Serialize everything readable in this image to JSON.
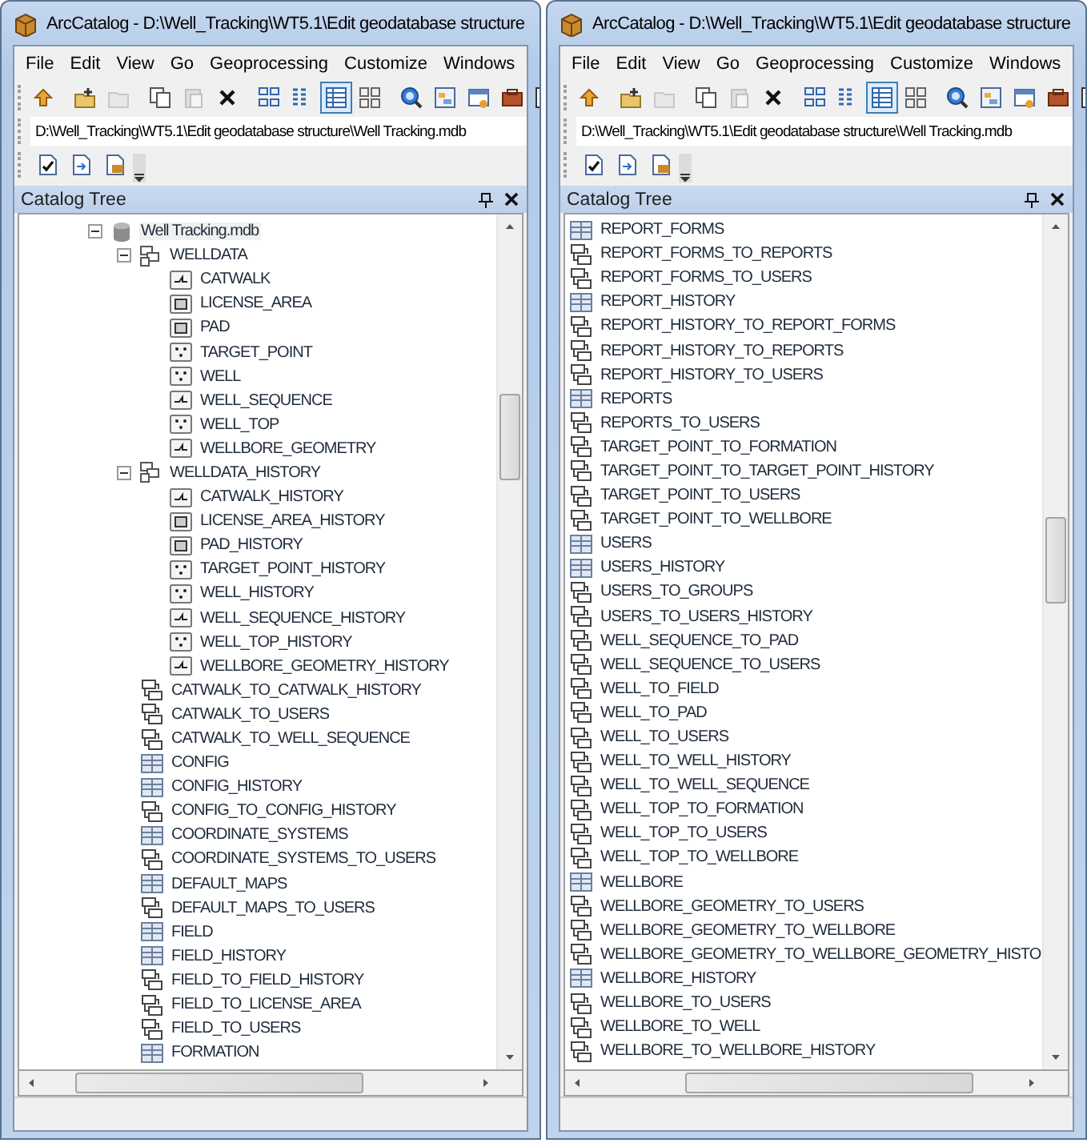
{
  "windows": [
    {
      "title": "ArcCatalog - D:\\Well_Tracking\\WT5.1\\Edit geodatabase structure",
      "menu": [
        "File",
        "Edit",
        "View",
        "Go",
        "Geoprocessing",
        "Customize",
        "Windows"
      ],
      "toolbar": [
        {
          "kind": "up",
          "disabled": false
        },
        {
          "kind": "separator"
        },
        {
          "kind": "connect",
          "disabled": false
        },
        {
          "kind": "disconnect",
          "disabled": true
        },
        {
          "kind": "separator"
        },
        {
          "kind": "copy",
          "disabled": false
        },
        {
          "kind": "paste",
          "disabled": true
        },
        {
          "kind": "delete",
          "disabled": false
        },
        {
          "kind": "separator"
        },
        {
          "kind": "view-large",
          "selected": false
        },
        {
          "kind": "view-list",
          "selected": false
        },
        {
          "kind": "view-details",
          "selected": true
        },
        {
          "kind": "view-thumbnails",
          "selected": false
        },
        {
          "kind": "separator"
        },
        {
          "kind": "search",
          "disabled": false
        },
        {
          "kind": "catalog",
          "disabled": false
        },
        {
          "kind": "window",
          "disabled": false
        },
        {
          "kind": "toolbox",
          "disabled": false
        },
        {
          "kind": "python",
          "disabled": false
        }
      ],
      "path": "D:\\Well_Tracking\\WT5.1\\Edit geodatabase structure\\Well Tracking.mdb",
      "panel_title": "Catalog Tree",
      "tree": [
        {
          "label": "Well Tracking.mdb",
          "kind": "database",
          "selected": true,
          "expanded": true,
          "children": [
            {
              "label": "WELLDATA",
              "kind": "dataset",
              "selected": false,
              "expanded": true,
              "children": [
                {
                  "label": "CATWALK",
                  "kind": "line",
                  "selected": false
                },
                {
                  "label": "LICENSE_AREA",
                  "kind": "polygon",
                  "selected": false
                },
                {
                  "label": "PAD",
                  "kind": "polygon",
                  "selected": false
                },
                {
                  "label": "TARGET_POINT",
                  "kind": "point",
                  "selected": false
                },
                {
                  "label": "WELL",
                  "kind": "point",
                  "selected": false
                },
                {
                  "label": "WELL_SEQUENCE",
                  "kind": "line",
                  "selected": false
                },
                {
                  "label": "WELL_TOP",
                  "kind": "point",
                  "selected": false
                },
                {
                  "label": "WELLBORE_GEOMETRY",
                  "kind": "line",
                  "selected": false
                }
              ]
            },
            {
              "label": "WELLDATA_HISTORY",
              "kind": "dataset",
              "selected": false,
              "expanded": true,
              "children": [
                {
                  "label": "CATWALK_HISTORY",
                  "kind": "line",
                  "selected": false
                },
                {
                  "label": "LICENSE_AREA_HISTORY",
                  "kind": "polygon",
                  "selected": false
                },
                {
                  "label": "PAD_HISTORY",
                  "kind": "polygon",
                  "selected": false
                },
                {
                  "label": "TARGET_POINT_HISTORY",
                  "kind": "point",
                  "selected": false
                },
                {
                  "label": "WELL_HISTORY",
                  "kind": "point",
                  "selected": false
                },
                {
                  "label": "WELL_SEQUENCE_HISTORY",
                  "kind": "line",
                  "selected": false
                },
                {
                  "label": "WELL_TOP_HISTORY",
                  "kind": "point",
                  "selected": false
                },
                {
                  "label": "WELLBORE_GEOMETRY_HISTORY",
                  "kind": "line",
                  "selected": false
                }
              ]
            },
            {
              "label": "CATWALK_TO_CATWALK_HISTORY",
              "kind": "relationship",
              "selected": false
            },
            {
              "label": "CATWALK_TO_USERS",
              "kind": "relationship",
              "selected": false
            },
            {
              "label": "CATWALK_TO_WELL_SEQUENCE",
              "kind": "relationship",
              "selected": false
            },
            {
              "label": "CONFIG",
              "kind": "table",
              "selected": false
            },
            {
              "label": "CONFIG_HISTORY",
              "kind": "table",
              "selected": false
            },
            {
              "label": "CONFIG_TO_CONFIG_HISTORY",
              "kind": "relationship",
              "selected": false
            },
            {
              "label": "COORDINATE_SYSTEMS",
              "kind": "table",
              "selected": false
            },
            {
              "label": "COORDINATE_SYSTEMS_TO_USERS",
              "kind": "relationship",
              "selected": false
            },
            {
              "label": "DEFAULT_MAPS",
              "kind": "table",
              "selected": false
            },
            {
              "label": "DEFAULT_MAPS_TO_USERS",
              "kind": "relationship",
              "selected": false
            },
            {
              "label": "FIELD",
              "kind": "table",
              "selected": false
            },
            {
              "label": "FIELD_HISTORY",
              "kind": "table",
              "selected": false
            },
            {
              "label": "FIELD_TO_FIELD_HISTORY",
              "kind": "relationship",
              "selected": false
            },
            {
              "label": "FIELD_TO_LICENSE_AREA",
              "kind": "relationship",
              "selected": false
            },
            {
              "label": "FIELD_TO_USERS",
              "kind": "relationship",
              "selected": false
            },
            {
              "label": "FORMATION",
              "kind": "table",
              "selected": false
            }
          ]
        }
      ]
    },
    {
      "title": "ArcCatalog - D:\\Well_Tracking\\WT5.1\\Edit geodatabase structure",
      "menu": [
        "File",
        "Edit",
        "View",
        "Go",
        "Geoprocessing",
        "Customize",
        "Windows"
      ],
      "toolbar": [
        {
          "kind": "up",
          "disabled": false
        },
        {
          "kind": "separator"
        },
        {
          "kind": "connect",
          "disabled": false
        },
        {
          "kind": "disconnect",
          "disabled": true
        },
        {
          "kind": "separator"
        },
        {
          "kind": "copy",
          "disabled": false
        },
        {
          "kind": "paste",
          "disabled": true
        },
        {
          "kind": "delete",
          "disabled": false
        },
        {
          "kind": "separator"
        },
        {
          "kind": "view-large",
          "selected": false
        },
        {
          "kind": "view-list",
          "selected": false
        },
        {
          "kind": "view-details",
          "selected": true
        },
        {
          "kind": "view-thumbnails",
          "selected": false
        },
        {
          "kind": "separator"
        },
        {
          "kind": "search",
          "disabled": false
        },
        {
          "kind": "catalog",
          "disabled": false
        },
        {
          "kind": "window",
          "disabled": false
        },
        {
          "kind": "toolbox",
          "disabled": false
        },
        {
          "kind": "python",
          "disabled": false
        }
      ],
      "path": "D:\\Well_Tracking\\WT5.1\\Edit geodatabase structure\\Well Tracking.mdb",
      "panel_title": "Catalog Tree",
      "tree": [
        {
          "label": "REPORT_FORMS",
          "kind": "table",
          "selected": false
        },
        {
          "label": "REPORT_FORMS_TO_REPORTS",
          "kind": "relationship",
          "selected": false
        },
        {
          "label": "REPORT_FORMS_TO_USERS",
          "kind": "relationship",
          "selected": false
        },
        {
          "label": "REPORT_HISTORY",
          "kind": "table",
          "selected": false
        },
        {
          "label": "REPORT_HISTORY_TO_REPORT_FORMS",
          "kind": "relationship",
          "selected": false
        },
        {
          "label": "REPORT_HISTORY_TO_REPORTS",
          "kind": "relationship",
          "selected": false
        },
        {
          "label": "REPORT_HISTORY_TO_USERS",
          "kind": "relationship",
          "selected": false
        },
        {
          "label": "REPORTS",
          "kind": "table",
          "selected": false
        },
        {
          "label": "REPORTS_TO_USERS",
          "kind": "relationship",
          "selected": false
        },
        {
          "label": "TARGET_POINT_TO_FORMATION",
          "kind": "relationship",
          "selected": false
        },
        {
          "label": "TARGET_POINT_TO_TARGET_POINT_HISTORY",
          "kind": "relationship",
          "selected": false
        },
        {
          "label": "TARGET_POINT_TO_USERS",
          "kind": "relationship",
          "selected": false
        },
        {
          "label": "TARGET_POINT_TO_WELLBORE",
          "kind": "relationship",
          "selected": false
        },
        {
          "label": "USERS",
          "kind": "table",
          "selected": false
        },
        {
          "label": "USERS_HISTORY",
          "kind": "table",
          "selected": false
        },
        {
          "label": "USERS_TO_GROUPS",
          "kind": "relationship",
          "selected": false
        },
        {
          "label": "USERS_TO_USERS_HISTORY",
          "kind": "relationship",
          "selected": false
        },
        {
          "label": "WELL_SEQUENCE_TO_PAD",
          "kind": "relationship",
          "selected": false
        },
        {
          "label": "WELL_SEQUENCE_TO_USERS",
          "kind": "relationship",
          "selected": false
        },
        {
          "label": "WELL_TO_FIELD",
          "kind": "relationship",
          "selected": false
        },
        {
          "label": "WELL_TO_PAD",
          "kind": "relationship",
          "selected": false
        },
        {
          "label": "WELL_TO_USERS",
          "kind": "relationship",
          "selected": false
        },
        {
          "label": "WELL_TO_WELL_HISTORY",
          "kind": "relationship",
          "selected": false
        },
        {
          "label": "WELL_TO_WELL_SEQUENCE",
          "kind": "relationship",
          "selected": false
        },
        {
          "label": "WELL_TOP_TO_FORMATION",
          "kind": "relationship",
          "selected": false
        },
        {
          "label": "WELL_TOP_TO_USERS",
          "kind": "relationship",
          "selected": false
        },
        {
          "label": "WELL_TOP_TO_WELLBORE",
          "kind": "relationship",
          "selected": false
        },
        {
          "label": "WELLBORE",
          "kind": "table",
          "selected": false
        },
        {
          "label": "WELLBORE_GEOMETRY_TO_USERS",
          "kind": "relationship",
          "selected": false
        },
        {
          "label": "WELLBORE_GEOMETRY_TO_WELLBORE",
          "kind": "relationship",
          "selected": false
        },
        {
          "label": "WELLBORE_GEOMETRY_TO_WELLBORE_GEOMETRY_HISTO",
          "kind": "relationship",
          "selected": false
        },
        {
          "label": "WELLBORE_HISTORY",
          "kind": "table",
          "selected": false
        },
        {
          "label": "WELLBORE_TO_USERS",
          "kind": "relationship",
          "selected": false
        },
        {
          "label": "WELLBORE_TO_WELL",
          "kind": "relationship",
          "selected": false
        },
        {
          "label": "WELLBORE_TO_WELLBORE_HISTORY",
          "kind": "relationship",
          "selected": false
        }
      ]
    }
  ]
}
